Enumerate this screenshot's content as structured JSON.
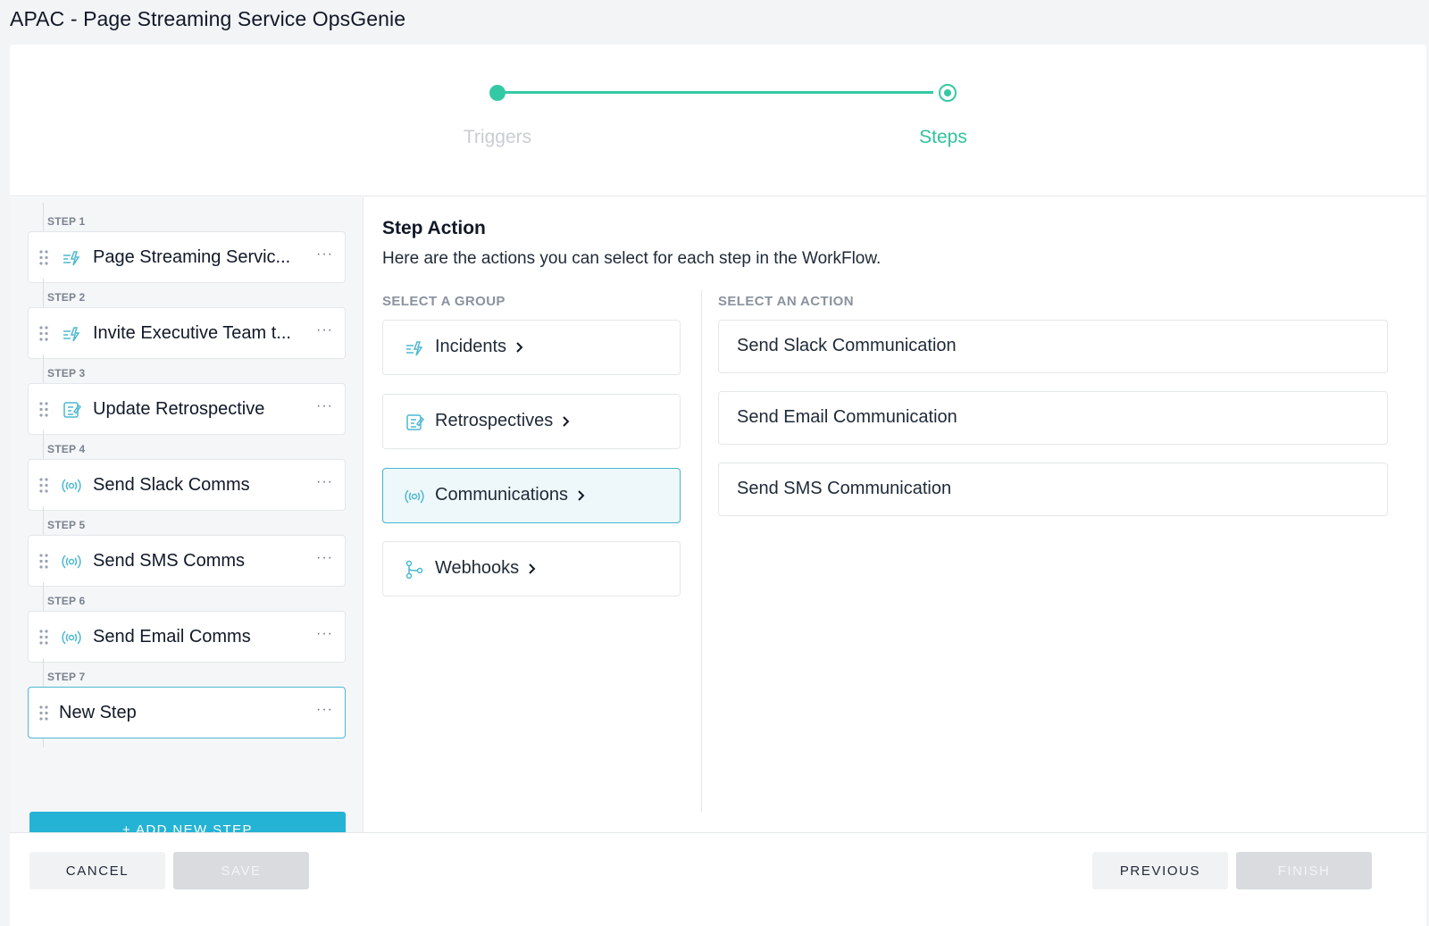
{
  "page": {
    "title": "APAC - Page Streaming Service OpsGenie"
  },
  "stepper": {
    "step1": "Triggers",
    "step2": "Steps"
  },
  "steps": [
    {
      "label": "STEP 1",
      "name": "Page Streaming Servic...",
      "icon": "incident-icon"
    },
    {
      "label": "STEP 2",
      "name": "Invite Executive Team t...",
      "icon": "incident-icon"
    },
    {
      "label": "STEP 3",
      "name": "Update Retrospective",
      "icon": "retrospective-icon"
    },
    {
      "label": "STEP 4",
      "name": "Send Slack Comms",
      "icon": "broadcast-icon"
    },
    {
      "label": "STEP 5",
      "name": "Send SMS Comms",
      "icon": "broadcast-icon"
    },
    {
      "label": "STEP 6",
      "name": "Send Email Comms",
      "icon": "broadcast-icon"
    },
    {
      "label": "STEP 7",
      "name": "New Step",
      "icon": ""
    }
  ],
  "add_step_label": "+  ADD NEW STEP",
  "main": {
    "heading": "Step Action",
    "description": "Here are the actions you can select for each step in the WorkFlow.",
    "group_header": "SELECT A GROUP",
    "action_header": "SELECT AN ACTION",
    "groups": [
      {
        "name": "Incidents",
        "icon": "incident-icon"
      },
      {
        "name": "Retrospectives",
        "icon": "retrospective-icon"
      },
      {
        "name": "Communications",
        "icon": "broadcast-icon"
      },
      {
        "name": "Webhooks",
        "icon": "webhook-icon"
      }
    ],
    "actions": [
      "Send Slack Communication",
      "Send Email Communication",
      "Send SMS Communication"
    ]
  },
  "footer": {
    "cancel": "CANCEL",
    "save": "SAVE",
    "previous": "PREVIOUS",
    "finish": "FINISH"
  },
  "colors": {
    "accent": "#24b3d4",
    "stepper": "#34c9a5"
  }
}
